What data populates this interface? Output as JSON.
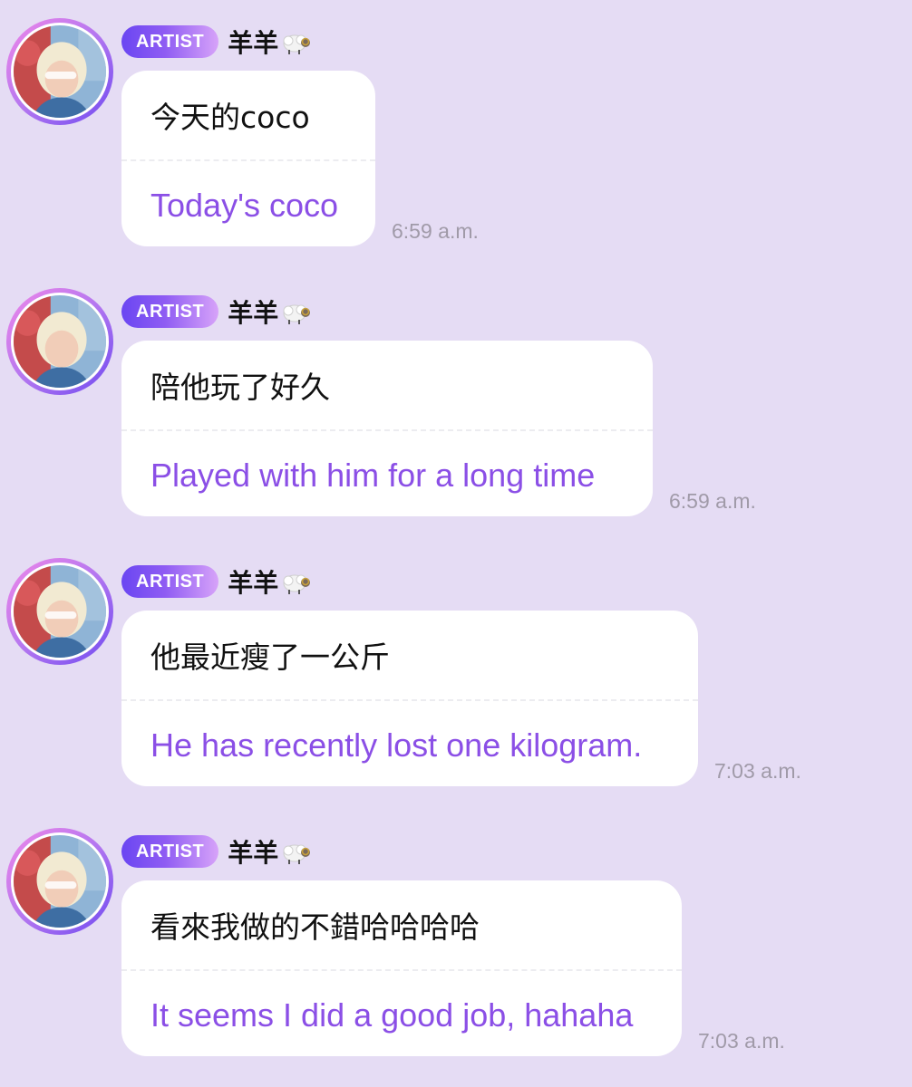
{
  "messages": [
    {
      "badge": "ARTIST",
      "username": "羊羊",
      "username_icon": "sheep-icon",
      "original": "今天的coco",
      "translation": "Today's coco",
      "time": "6:59 a.m."
    },
    {
      "badge": "ARTIST",
      "username": "羊羊",
      "username_icon": "sheep-icon",
      "original": "陪他玩了好久",
      "translation": "Played with him for a long time",
      "time": "6:59 a.m."
    },
    {
      "badge": "ARTIST",
      "username": "羊羊",
      "username_icon": "sheep-icon",
      "original": "他最近瘦了一公斤",
      "translation": "He has recently lost one kilogram.",
      "time": "7:03 a.m."
    },
    {
      "badge": "ARTIST",
      "username": "羊羊",
      "username_icon": "sheep-icon",
      "original": "看來我做的不錯哈哈哈哈",
      "translation": "It seems I did a good job, hahaha",
      "time": "7:03 a.m."
    }
  ],
  "colors": {
    "background": "#e5dcf4",
    "bubble": "#ffffff",
    "translation_text": "#8b4fe6",
    "badge_gradient_start": "#6a46f2",
    "badge_gradient_end": "#d7a3f9",
    "timestamp": "#a09aa8"
  }
}
